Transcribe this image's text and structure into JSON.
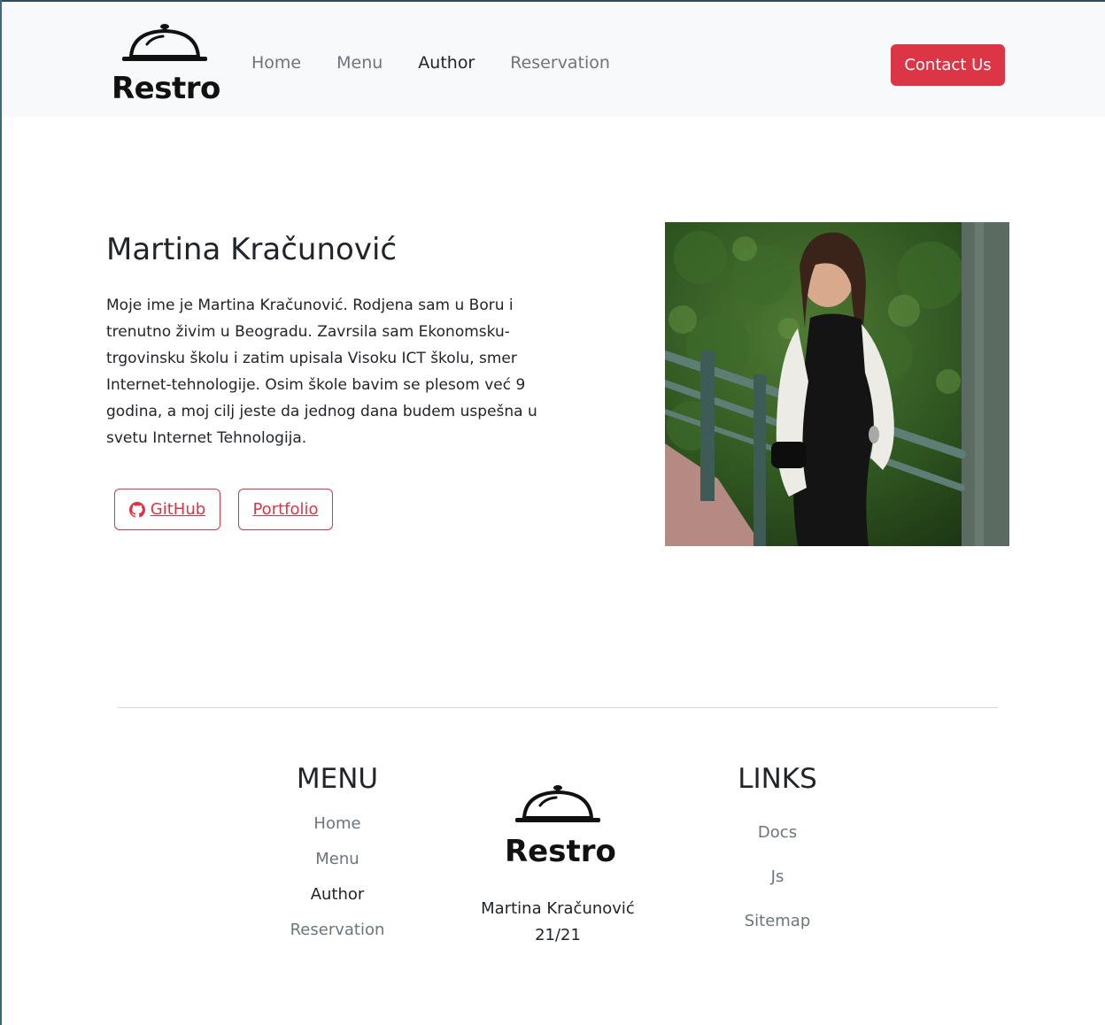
{
  "brand": {
    "name": "Restro",
    "icon": "cloche-icon"
  },
  "nav": {
    "items": [
      {
        "label": "Home",
        "active": false
      },
      {
        "label": "Menu",
        "active": false
      },
      {
        "label": "Author",
        "active": true
      },
      {
        "label": "Reservation",
        "active": false
      }
    ],
    "contact_label": "Contact Us"
  },
  "author": {
    "name": "Martina Kračunović",
    "bio": "Moje ime je Martina Kračunović. Rodjena sam u Boru i trenutno živim u Beogradu. Zavrsila sam Ekonomsku-trgovinsku školu i zatim upisala Visoku ICT školu, smer Internet-tehnologije. Osim škole bavim se plesom već 9 godina, a moj cilj jeste da jednog dana budem uspešna u svetu Internet Tehnologija.",
    "github_label": "GitHub",
    "portfolio_label": "Portfolio"
  },
  "footer": {
    "menu": {
      "title": "MENU",
      "items": [
        "Home",
        "Menu",
        "Author",
        "Reservation"
      ]
    },
    "links": {
      "title": "LINKS",
      "items": [
        "Docs",
        "Js",
        "Sitemap"
      ]
    },
    "author_line1": "Martina Kračunović",
    "author_line2": "21/21"
  },
  "colors": {
    "accent": "#dc3545",
    "navbar_bg": "#f8f9fa",
    "muted": "#6c757d"
  }
}
